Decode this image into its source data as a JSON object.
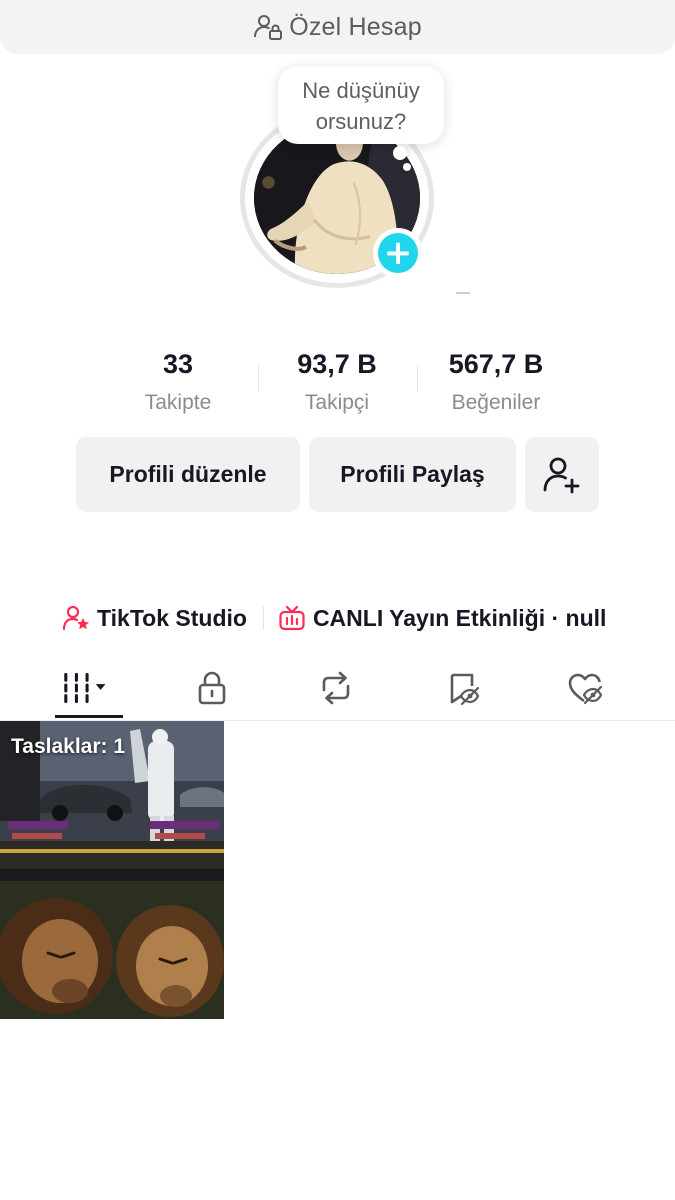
{
  "header": {
    "title": "Özel Hesap",
    "icon": "private-account-icon"
  },
  "profile": {
    "bubble_text_line1": "Ne düşünüy",
    "bubble_text_line2": "orsunuz?",
    "add_badge": "+"
  },
  "stats": [
    {
      "value": "33",
      "label": "Takipte"
    },
    {
      "value": "93,7 B",
      "label": "Takipçi"
    },
    {
      "value": "567,7 B",
      "label": "Beğeniler"
    }
  ],
  "buttons": {
    "edit_label": "Profili düzenle",
    "share_label": "Profili Paylaş",
    "add_friend_icon": "add-friend-icon"
  },
  "links": {
    "studio_label": "TikTok Studio",
    "live_label": "CANLI Yayın Etkinliği · null"
  },
  "tabs": [
    {
      "name": "videos",
      "icon": "grid-icon",
      "active": true
    },
    {
      "name": "private",
      "icon": "lock-icon"
    },
    {
      "name": "reposts",
      "icon": "repost-icon"
    },
    {
      "name": "favorites",
      "icon": "bookmark-hidden-icon"
    },
    {
      "name": "liked",
      "icon": "heart-hidden-icon"
    }
  ],
  "grid": {
    "drafts_label": "Taslaklar: 1"
  },
  "colors": {
    "accent": "#fe2c55",
    "badge": "#20d5ec",
    "text": "#161823",
    "muted": "#8a8b91",
    "button_bg": "#f1f1f2"
  }
}
